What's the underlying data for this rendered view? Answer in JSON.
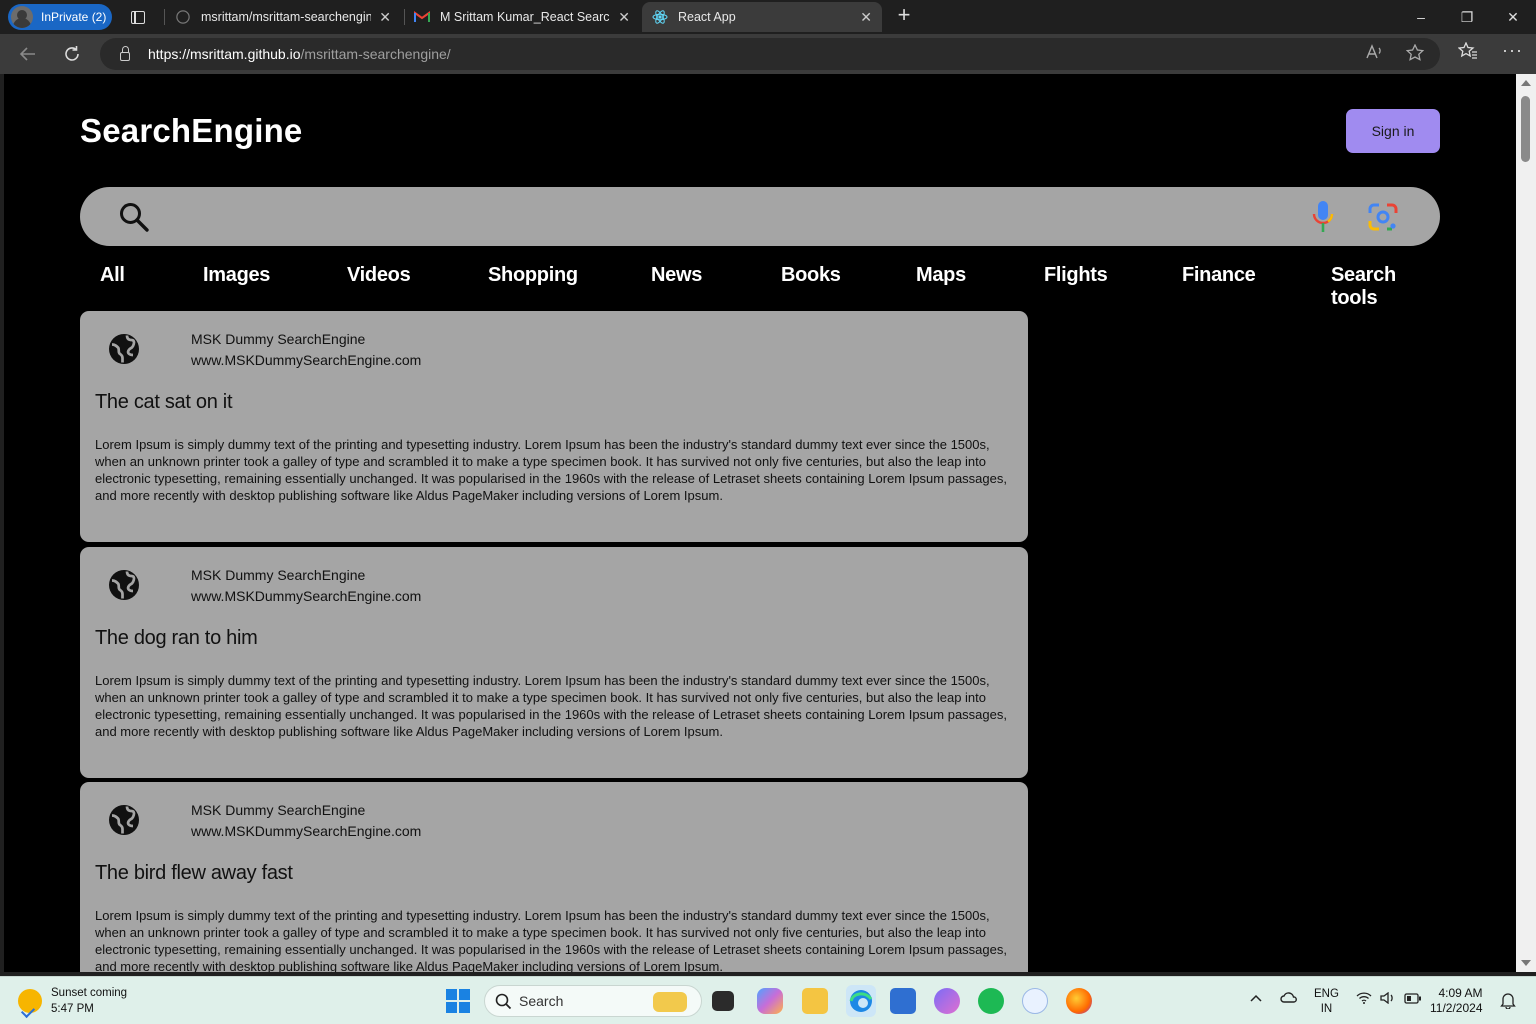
{
  "browser": {
    "profile_label": "InPrivate (2)",
    "tabs": [
      {
        "title": "msrittam/msrittam-searchengine",
        "close": "✕"
      },
      {
        "title": "M Srittam Kumar_React Search En",
        "close": "✕"
      },
      {
        "title": "React App",
        "close": "✕"
      }
    ],
    "new_tab": "+",
    "window_controls": {
      "minimize": "–",
      "restore": "❐",
      "close": "✕"
    },
    "url_host": "https://msrittam.github.io",
    "url_path": "/msrittam-searchengine/"
  },
  "page": {
    "logo": "SearchEngine",
    "signin_label": "Sign in",
    "search": {
      "placeholder": "",
      "value": ""
    },
    "nav": [
      "All",
      "Images",
      "Videos",
      "Shopping",
      "News",
      "Books",
      "Maps",
      "Flights",
      "Finance",
      "Search tools"
    ],
    "results": [
      {
        "site": "MSK Dummy SearchEngine",
        "url": "www.MSKDummySearchEngine.com",
        "title": "The cat sat on it",
        "snippet": "Lorem Ipsum is simply dummy text of the printing and typesetting industry. Lorem Ipsum has been the industry's standard dummy text ever since the 1500s, when an unknown printer took a galley of type and scrambled it to make a type specimen book. It has survived not only five centuries, but also the leap into electronic typesetting, remaining essentially unchanged. It was popularised in the 1960s with the release of Letraset sheets containing Lorem Ipsum passages, and more recently with desktop publishing software like Aldus PageMaker including versions of Lorem Ipsum."
      },
      {
        "site": "MSK Dummy SearchEngine",
        "url": "www.MSKDummySearchEngine.com",
        "title": "The dog ran to him",
        "snippet": "Lorem Ipsum is simply dummy text of the printing and typesetting industry. Lorem Ipsum has been the industry's standard dummy text ever since the 1500s, when an unknown printer took a galley of type and scrambled it to make a type specimen book. It has survived not only five centuries, but also the leap into electronic typesetting, remaining essentially unchanged. It was popularised in the 1960s with the release of Letraset sheets containing Lorem Ipsum passages, and more recently with desktop publishing software like Aldus PageMaker including versions of Lorem Ipsum."
      },
      {
        "site": "MSK Dummy SearchEngine",
        "url": "www.MSKDummySearchEngine.com",
        "title": "The bird flew away fast",
        "snippet": "Lorem Ipsum is simply dummy text of the printing and typesetting industry. Lorem Ipsum has been the industry's standard dummy text ever since the 1500s, when an unknown printer took a galley of type and scrambled it to make a type specimen book. It has survived not only five centuries, but also the leap into electronic typesetting, remaining essentially unchanged. It was popularised in the 1960s with the release of Letraset sheets containing Lorem Ipsum passages, and more recently with desktop publishing software like Aldus PageMaker including versions of Lorem Ipsum."
      }
    ]
  },
  "taskbar": {
    "weather_title": "Sunset coming",
    "weather_time": "5:47 PM",
    "search_label": "Search",
    "lang_top": "ENG",
    "lang_bottom": "IN",
    "time": "4:09 AM",
    "date": "11/2/2024"
  },
  "colors": {
    "signin_bg": "#a08bf0",
    "card_bg": "#a5a5a5",
    "page_bg": "#000000"
  }
}
